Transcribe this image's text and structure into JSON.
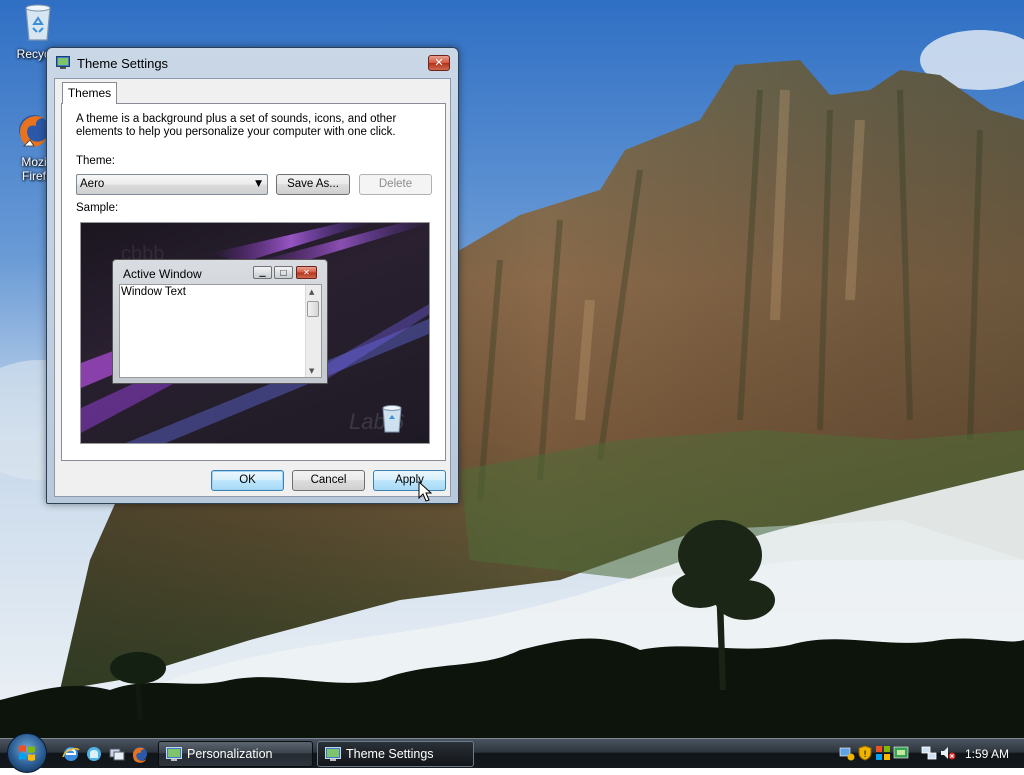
{
  "desktop": {
    "icons": [
      {
        "label": "Recycle",
        "icon": "recycle-bin-icon"
      },
      {
        "label": "Mozi",
        "label2": "Firef",
        "icon": "firefox-icon"
      }
    ]
  },
  "dialog": {
    "title": "Theme Settings",
    "title_icon": "theme-settings-icon",
    "close_label": "✕",
    "tab": "Themes",
    "description": "A theme is a background plus a set of sounds, icons, and other elements to help you personalize your computer with one click.",
    "theme_label": "Theme:",
    "theme_value": "Aero",
    "save_as_label": "Save As...",
    "delete_label": "Delete",
    "sample_label": "Sample:",
    "sample": {
      "window_title": "Active Window",
      "window_text": "Window Text",
      "watermark": "Lab 6"
    },
    "ok_label": "OK",
    "cancel_label": "Cancel",
    "apply_label": "Apply"
  },
  "taskbar": {
    "start_icon": "windows-start-icon",
    "quick_launch": [
      "internet-explorer-icon",
      "windows-explorer-icon",
      "switch-windows-icon",
      "firefox-icon"
    ],
    "tasks": [
      {
        "label": "Personalization",
        "icon": "personalization-icon",
        "active": false
      },
      {
        "label": "Theme Settings",
        "icon": "theme-settings-icon",
        "active": true
      }
    ],
    "tray_icons": [
      "network-update-icon",
      "security-shield-icon",
      "windows-update-icon",
      "color-icon",
      "network-icon",
      "volume-muted-icon"
    ],
    "clock": "1:59 AM"
  }
}
